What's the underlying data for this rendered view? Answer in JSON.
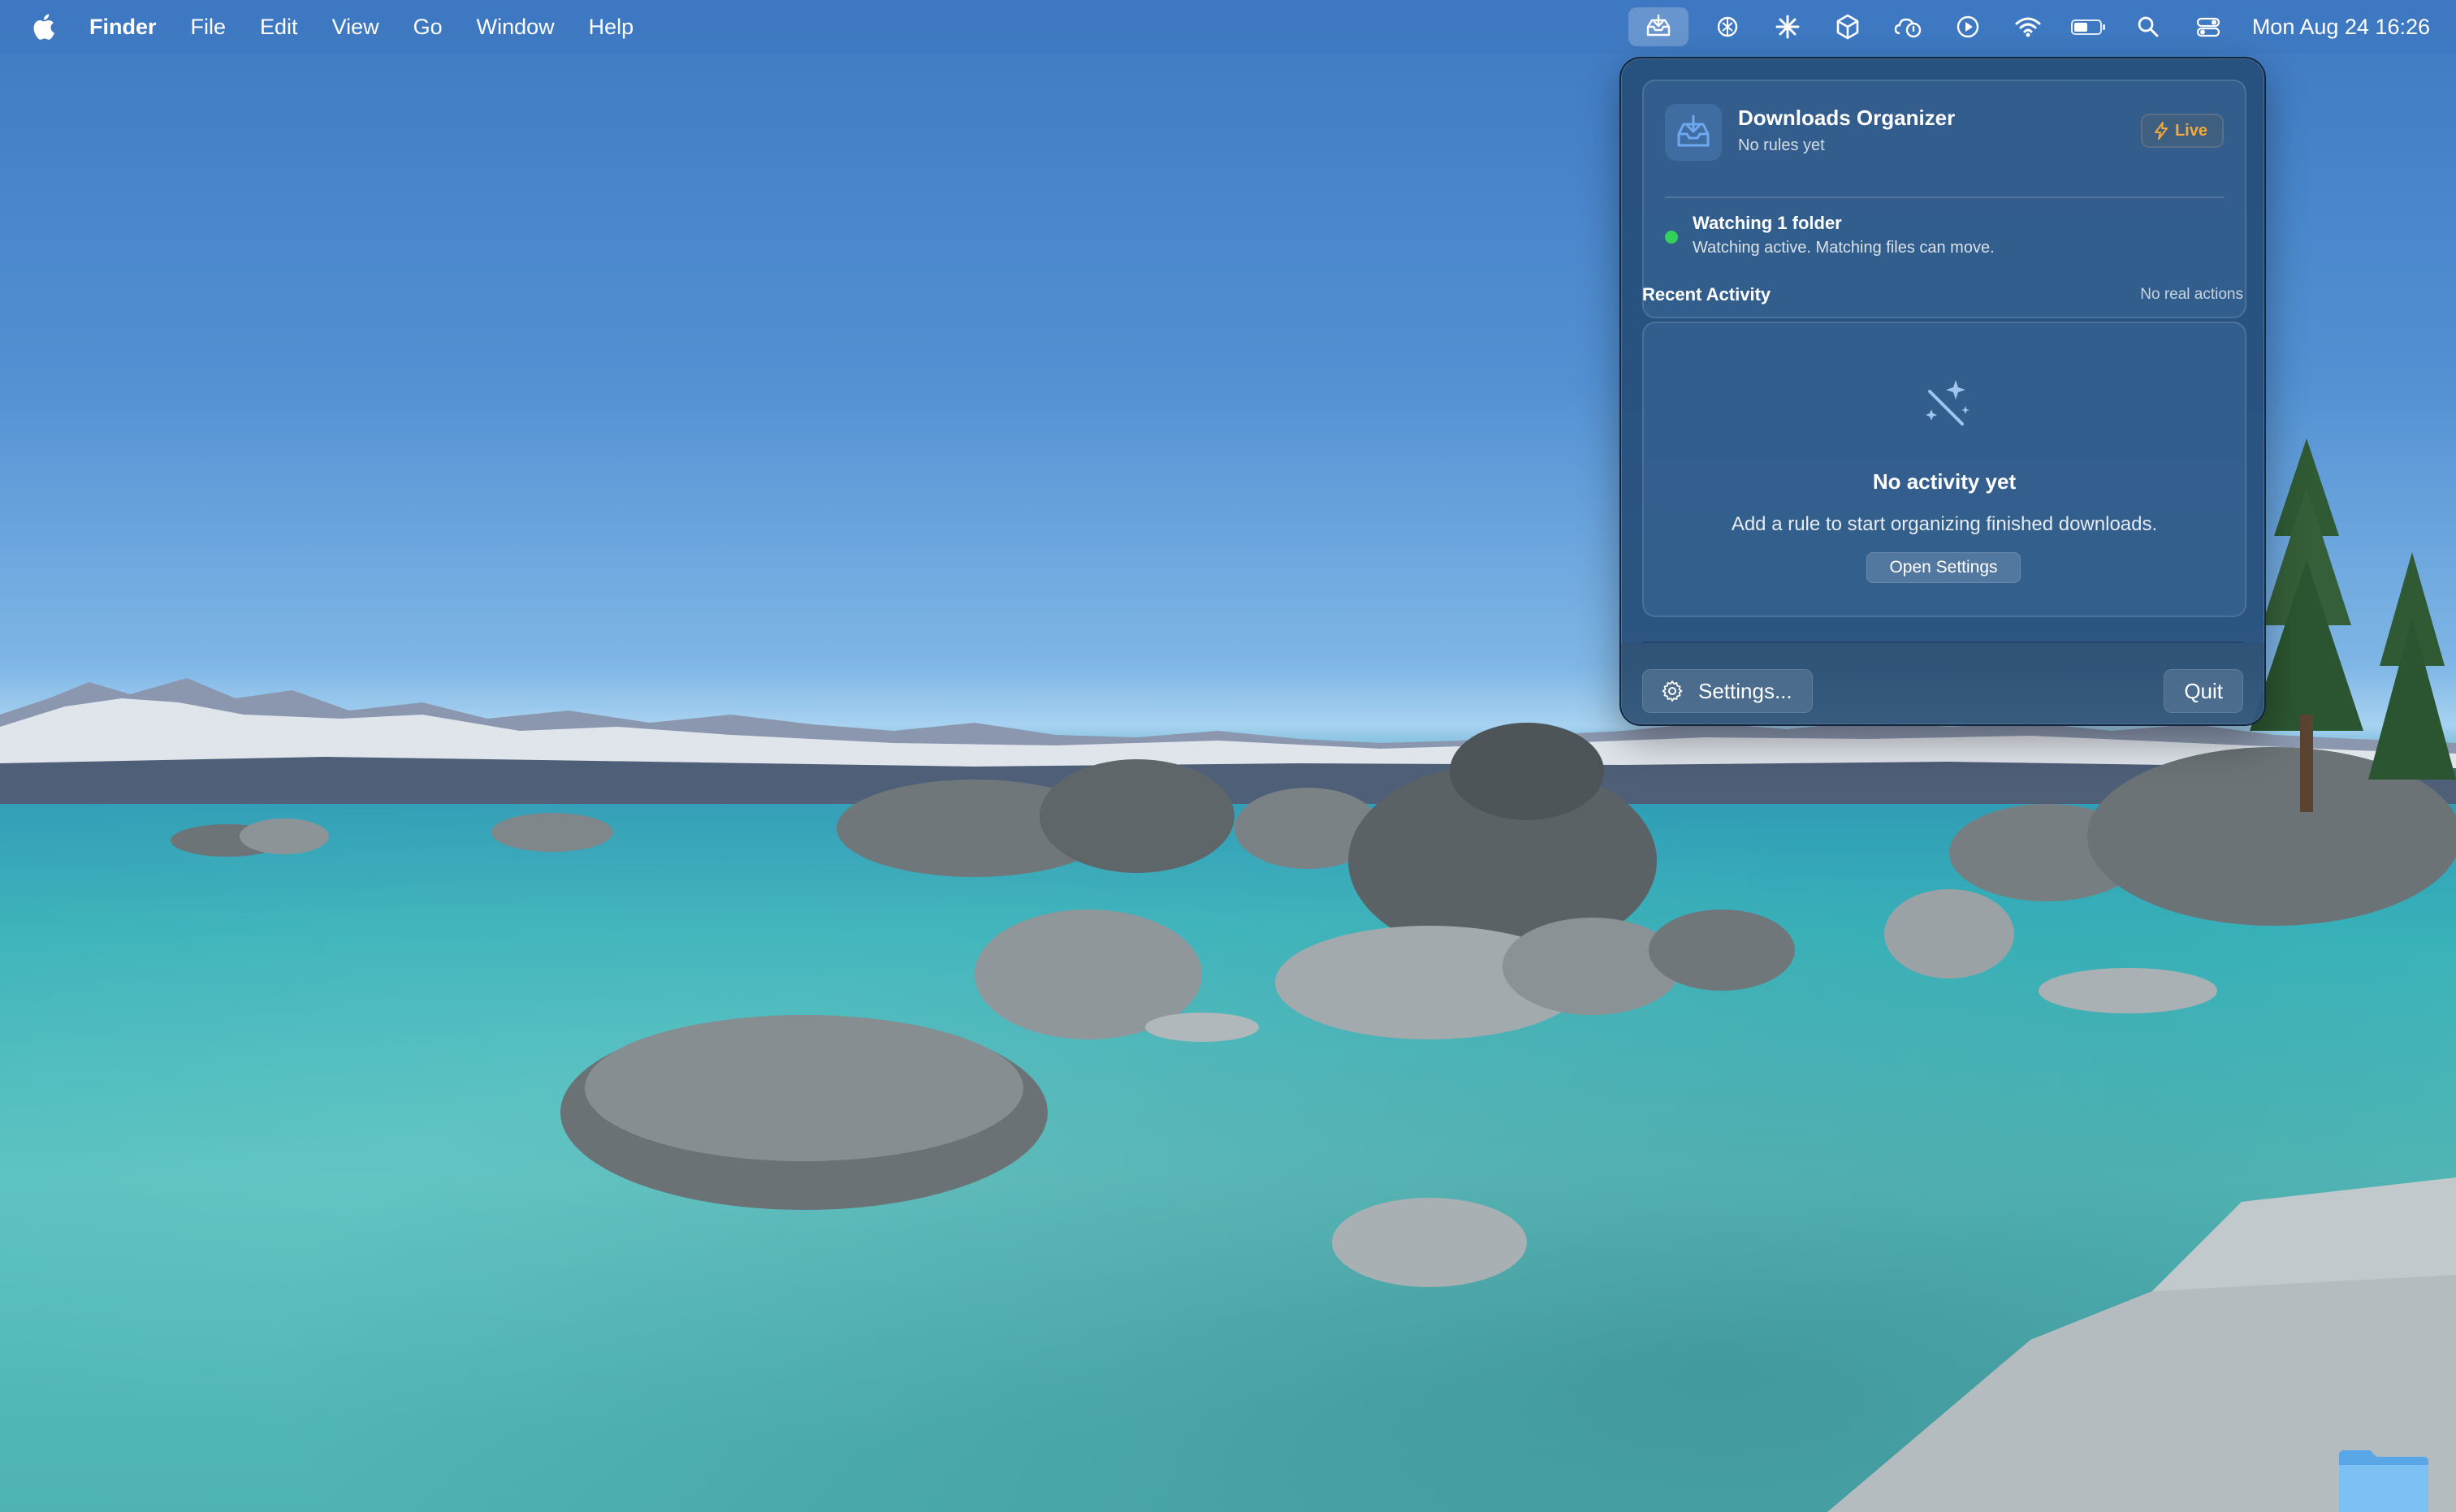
{
  "menubar": {
    "app_name": "Finder",
    "items": [
      "File",
      "Edit",
      "View",
      "Go",
      "Window",
      "Help"
    ],
    "clock": "Mon Aug 24  16:26",
    "status_icons": [
      "downloads-organizer-icon",
      "chatgpt-icon",
      "claude-icon",
      "unity-icon",
      "cloud-status-icon",
      "play-icon",
      "wifi-icon",
      "battery-icon",
      "spotlight-search-icon",
      "control-center-icon"
    ]
  },
  "panel": {
    "app_title": "Downloads Organizer",
    "app_subtitle": "No rules yet",
    "live_badge": "Live",
    "watch_title": "Watching 1 folder",
    "watch_detail": "Watching active. Matching files can move.",
    "recent_label": "Recent Activity",
    "recent_note": "No real actions",
    "empty_title": "No activity yet",
    "empty_detail": "Add a rule to start organizing finished downloads.",
    "open_settings_label": "Open Settings",
    "settings_label": "Settings...",
    "quit_label": "Quit"
  },
  "colors": {
    "panel_bg": "#264e7a",
    "live_accent": "#f3a93c",
    "status_active": "#33d15a"
  }
}
